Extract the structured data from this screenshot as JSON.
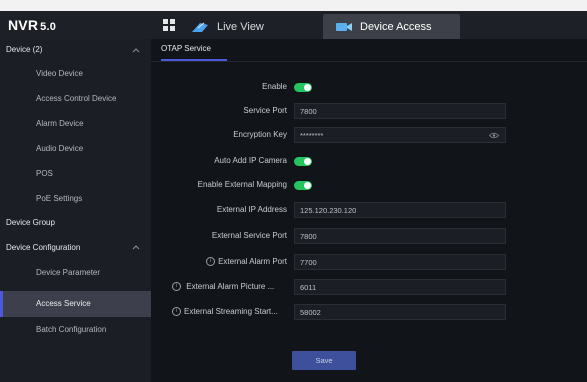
{
  "app": {
    "logo": "NVR",
    "version": "5.0"
  },
  "tabs": {
    "live_view": "Live View",
    "device_access": "Device Access"
  },
  "sidebar": {
    "group1": {
      "label": "Device (2)"
    },
    "group1_items": [
      {
        "label": "Video Device"
      },
      {
        "label": "Access Control Device"
      },
      {
        "label": "Alarm Device"
      },
      {
        "label": "Audio Device"
      },
      {
        "label": "POS"
      },
      {
        "label": "PoE Settings"
      }
    ],
    "group2": {
      "label": "Device Group"
    },
    "group3": {
      "label": "Device Configuration"
    },
    "group3_items": [
      {
        "label": "Device Parameter"
      },
      {
        "label": "Access Service"
      },
      {
        "label": "Batch Configuration"
      }
    ]
  },
  "subtab": {
    "label": "OTAP Service"
  },
  "form": {
    "enable": {
      "label": "Enable",
      "on": true
    },
    "service_port": {
      "label": "Service Port",
      "value": "7800"
    },
    "encryption_key": {
      "label": "Encryption Key",
      "value": "********"
    },
    "auto_add": {
      "label": "Auto Add IP Camera",
      "on": true
    },
    "external_mapping": {
      "label": "Enable External Mapping",
      "on": true
    },
    "external_ip": {
      "label": "External IP Address",
      "value": "125.120.230.120"
    },
    "external_service_port": {
      "label": "External Service Port",
      "value": "7800"
    },
    "external_alarm_port": {
      "label": "External Alarm Port",
      "value": "7700"
    },
    "external_alarm_picture": {
      "label": "External Alarm Picture ...",
      "value": "6011"
    },
    "external_streaming": {
      "label": "External Streaming Start...",
      "value": "58002"
    },
    "save_label": "Save"
  },
  "colors": {
    "accent": "#4a5ad9",
    "toggle_on": "#22c55e",
    "save_bg": "#3e4f9c"
  }
}
